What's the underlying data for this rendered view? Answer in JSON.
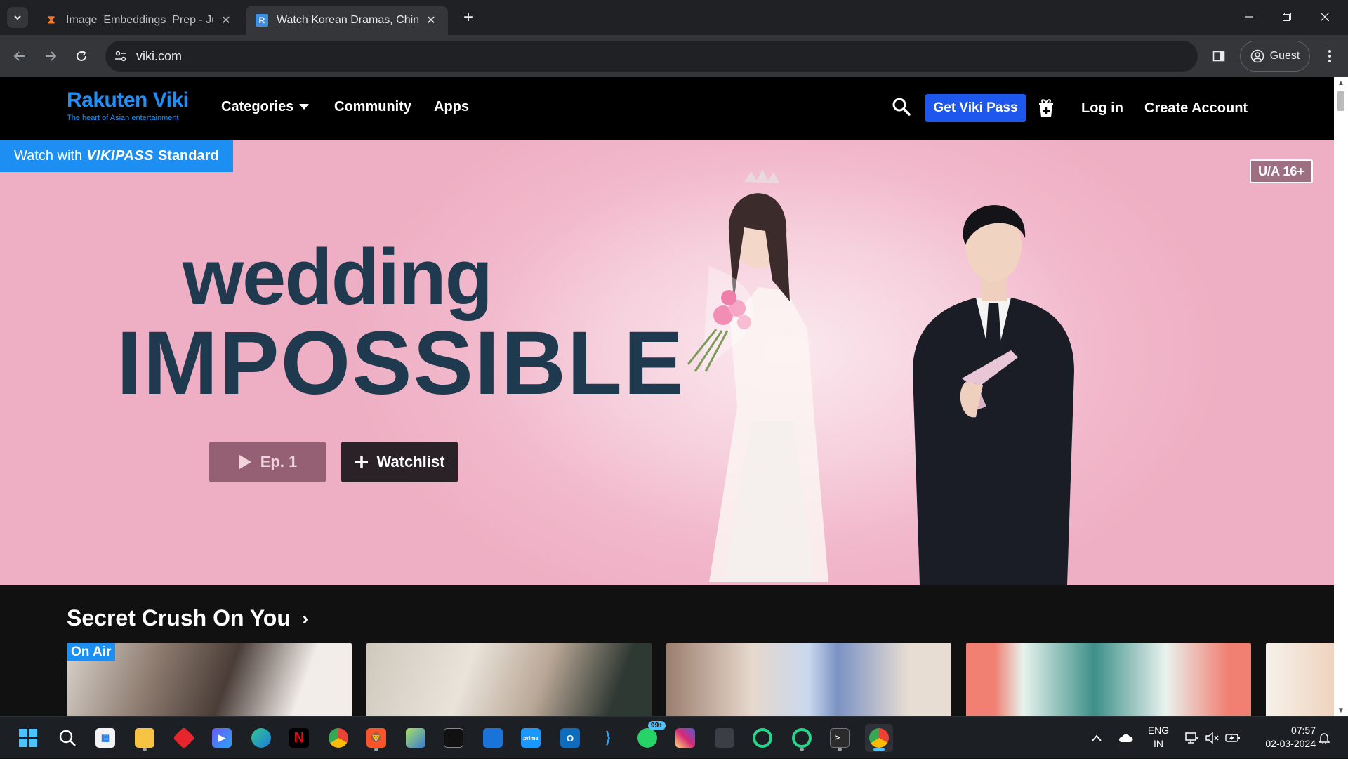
{
  "browser": {
    "tabs": [
      {
        "title": "Image_Embeddings_Prep - Jupy",
        "favicon": "jupyter-icon",
        "active": false
      },
      {
        "title": "Watch Korean Dramas, Chinese",
        "favicon": "rakuten-icon",
        "active": true
      }
    ],
    "address": "viki.com",
    "profile_label": "Guest"
  },
  "site": {
    "logo_text": "Rakuten Viki",
    "logo_tagline": "The heart of Asian entertainment",
    "nav": {
      "categories": "Categories",
      "community": "Community",
      "apps": "Apps"
    },
    "viki_pass_button": "Get Viki Pass",
    "login": "Log in",
    "create_account": "Create Account",
    "accent_color": "#1d57ee",
    "brand_color": "#1e8ff7"
  },
  "hero": {
    "badge_prefix": "Watch with",
    "badge_brand": "VIKIPASS",
    "badge_suffix": "Standard",
    "rating": "U/A 16+",
    "title_line1": "wedding",
    "title_line2": "IMPOSSIBLE",
    "play_button": "Ep. 1",
    "watchlist_button": "Watchlist"
  },
  "row": {
    "title": "Secret Crush On You",
    "cards": [
      {
        "badge": "On Air"
      },
      {
        "badge": ""
      },
      {
        "badge": ""
      },
      {
        "badge": ""
      },
      {
        "badge": ""
      }
    ]
  },
  "taskbar": {
    "lang_line1": "ENG",
    "lang_line2": "IN",
    "time": "07:57",
    "date": "02-03-2024",
    "whatsapp_badge": "99+"
  }
}
